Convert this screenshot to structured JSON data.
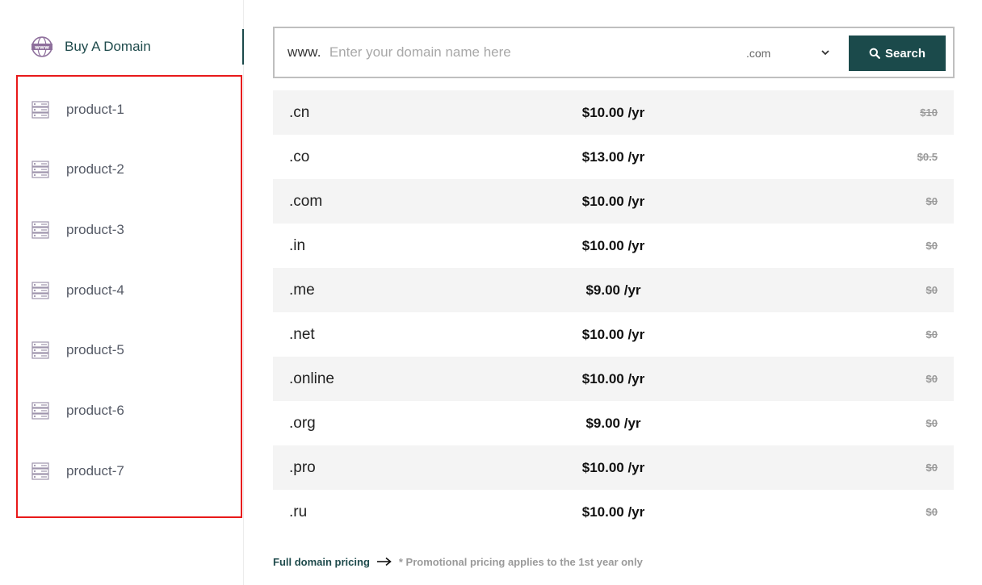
{
  "sidebar": {
    "buy_domain": {
      "label": "Buy A Domain",
      "icon": "www-globe-icon"
    },
    "products": [
      {
        "label": "product-1",
        "icon": "server-icon"
      },
      {
        "label": "product-2",
        "icon": "server-icon"
      },
      {
        "label": "product-3",
        "icon": "server-icon"
      },
      {
        "label": "product-4",
        "icon": "server-icon"
      },
      {
        "label": "product-5",
        "icon": "server-icon"
      },
      {
        "label": "product-6",
        "icon": "server-icon"
      },
      {
        "label": "product-7",
        "icon": "server-icon"
      }
    ]
  },
  "search": {
    "prefix": "www.",
    "placeholder": "Enter your domain name here",
    "value": "",
    "tld_selected": ".com",
    "button_label": "Search"
  },
  "pricing": {
    "rows": [
      {
        "tld": ".cn",
        "price": "$10.00 /yr",
        "old_price": "$10"
      },
      {
        "tld": ".co",
        "price": "$13.00 /yr",
        "old_price": "$0.5"
      },
      {
        "tld": ".com",
        "price": "$10.00 /yr",
        "old_price": "$0"
      },
      {
        "tld": ".in",
        "price": "$10.00 /yr",
        "old_price": "$0"
      },
      {
        "tld": ".me",
        "price": "$9.00 /yr",
        "old_price": "$0"
      },
      {
        "tld": ".net",
        "price": "$10.00 /yr",
        "old_price": "$0"
      },
      {
        "tld": ".online",
        "price": "$10.00 /yr",
        "old_price": "$0"
      },
      {
        "tld": ".org",
        "price": "$9.00 /yr",
        "old_price": "$0"
      },
      {
        "tld": ".pro",
        "price": "$10.00 /yr",
        "old_price": "$0"
      },
      {
        "tld": ".ru",
        "price": "$10.00 /yr",
        "old_price": "$0"
      }
    ]
  },
  "footer": {
    "full_pricing_link": "Full domain pricing",
    "promo_note": "* Promotional pricing applies to the 1st year only"
  },
  "colors": {
    "brand": "#1b4a4b",
    "highlight_border": "#e8191a",
    "row_alt": "#f4f4f4"
  }
}
